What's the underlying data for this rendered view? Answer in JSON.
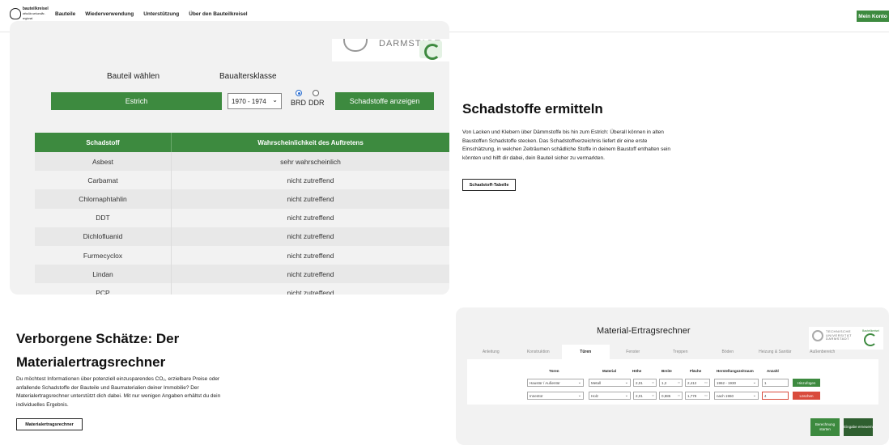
{
  "nav": {
    "logo_text": [
      "bauteilkreisel",
      "zirkulär-sekundär-regional"
    ],
    "links": [
      {
        "label": "Bauteile",
        "active": false
      },
      {
        "label": "Wiederverwendung",
        "active": true
      },
      {
        "label": "Unterstützung",
        "active": false
      },
      {
        "label": "Über den Bauteilkreisel",
        "active": false
      }
    ],
    "account_button": "Mein Konto"
  },
  "schadstoff_widget": {
    "logo_text": "DARMSTADT",
    "label_bauteil": "Bauteil wählen",
    "label_baualter": "Baualtersklasse",
    "bauteil_button": "Estrich",
    "year_select": "1970 - 1974",
    "radio_options": [
      {
        "label": "BRD",
        "checked": true
      },
      {
        "label": "DDR",
        "checked": false
      }
    ],
    "show_button": "Schadstoffe anzeigen",
    "table": {
      "headers": [
        "Schadstoff",
        "Wahrscheinlichkeit des Auftretens"
      ],
      "rows": [
        [
          "Asbest",
          "sehr wahrscheinlich"
        ],
        [
          "Carbamat",
          "nicht zutreffend"
        ],
        [
          "Chlornaphtahlin",
          "nicht zutreffend"
        ],
        [
          "DDT",
          "nicht zutreffend"
        ],
        [
          "Dichlofluanid",
          "nicht zutreffend"
        ],
        [
          "Furmecyclox",
          "nicht zutreffend"
        ],
        [
          "Lindan",
          "nicht zutreffend"
        ],
        [
          "PCP",
          "nicht zutreffend"
        ]
      ]
    }
  },
  "ermitteln": {
    "heading": "Schadstoffe ermitteln",
    "text": "Von Lacken und Klebern über Dämmstoffe bis hin zum Estrich: Überall können in alten Baustoffen Schadstoffe stecken. Das Schadstoffverzeichnis liefert dir eine erste Einschätzung, in welchen Zeiträumen schädliche Stoffe in deinem Baustoff enthalten sein könnten und hilft dir dabei, dein Bauteil sicher zu vermarkten.",
    "button": "Schadstoff-Tabelle"
  },
  "schaetze": {
    "heading": "Verborgene Schätze: Der Materialertragsrechner",
    "text": "Du möchtest Informationen über potenziell einzusparendes CO₂, erzielbare Preise oder anfallende Schadstoffe der Bauteile und Baumaterialien deiner Immobilie? Der Materialertragsrechner unterstützt dich dabei. Mit nur wenigen Angaben erhältst du dein individuelles Ergebnis.",
    "button": "Materialertragsrechner"
  },
  "rechner": {
    "title": "Material-Ertragsrechner",
    "logo_text": [
      "TECHNISCHE",
      "UNIVERSITÄT",
      "DARMSTADT"
    ],
    "badge_text": "Bauteilkreisel",
    "tabs": [
      {
        "label": "Anleitung",
        "active": false
      },
      {
        "label": "Konstruktion",
        "active": false
      },
      {
        "label": "Türen",
        "active": true
      },
      {
        "label": "Fenster",
        "active": false
      },
      {
        "label": "Treppen",
        "active": false
      },
      {
        "label": "Böden",
        "active": false
      },
      {
        "label": "Heizung & Sanitär",
        "active": false
      },
      {
        "label": "Außenbereich",
        "active": false
      }
    ],
    "headers": [
      "Türen",
      "Material",
      "Höhe",
      "Breite",
      "Fläche",
      "Herstellungszeitraum",
      "Anzahl"
    ],
    "rows": [
      {
        "tuer": "Haustür / Außentür",
        "material": "Metall",
        "hoehe": "2,01",
        "breite": "1,2",
        "flaeche": "2,412",
        "zeitraum": "1962 - 1930",
        "anzahl": "1",
        "action": "Hinzufügen"
      },
      {
        "tuer": "Innentür",
        "material": "Holz",
        "hoehe": "2,01",
        "breite": "0,885",
        "flaeche": "1,779",
        "zeitraum": "nach 1960",
        "anzahl": "4",
        "action": "Löschen"
      }
    ],
    "units": {
      "m": "m",
      "m2": "m²"
    },
    "button_berechnung": "Berechnung starten",
    "button_eingabe": "Eingabe erneuern"
  },
  "colors": {
    "accent": "#3d8a3f",
    "danger": "#d94b3c"
  }
}
